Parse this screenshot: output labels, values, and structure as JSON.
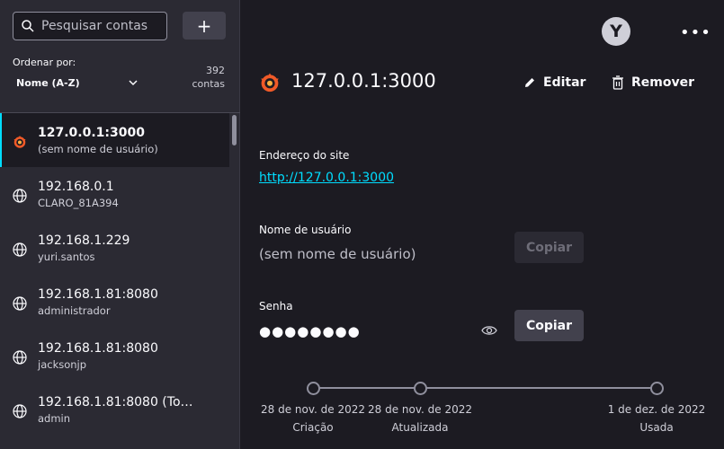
{
  "sidebar": {
    "search_placeholder": "Pesquisar contas",
    "add_label": "+",
    "sort_label": "Ordenar por:",
    "sort_value": "Nome (A-Z)",
    "count_number": "392",
    "count_unit": "contas",
    "items": [
      {
        "title": "127.0.0.1:3000",
        "subtitle": "(sem nome de usuário)",
        "icon": "grafana-logo-icon",
        "active": true
      },
      {
        "title": "192.168.0.1",
        "subtitle": "CLARO_81A394",
        "icon": "globe-icon"
      },
      {
        "title": "192.168.1.229",
        "subtitle": "yuri.santos",
        "icon": "globe-icon"
      },
      {
        "title": "192.168.1.81:8080",
        "subtitle": "administrador",
        "icon": "globe-icon"
      },
      {
        "title": "192.168.1.81:8080",
        "subtitle": "jacksonjp",
        "icon": "globe-icon"
      },
      {
        "title": "192.168.1.81:8080 (To…",
        "subtitle": "admin",
        "icon": "globe-icon"
      }
    ]
  },
  "header": {
    "avatar_letter": "Y",
    "menu_label": "•••"
  },
  "detail": {
    "title": "127.0.0.1:3000",
    "edit_label": "Editar",
    "remove_label": "Remover",
    "site_label": "Endereço do site",
    "site_url": "http://127.0.0.1:3000",
    "username_label": "Nome de usuário",
    "username_value": "(sem nome de usuário)",
    "password_label": "Senha",
    "password_value": "●●●●●●●●",
    "copy_label": "Copiar"
  },
  "timeline": [
    {
      "date": "28 de nov. de 2022",
      "label": "Criação"
    },
    {
      "date": "28 de nov. de 2022",
      "label": "Atualizada"
    },
    {
      "date": "1 de dez. de 2022",
      "label": "Usada"
    }
  ],
  "colors": {
    "accent": "#00ddff",
    "background": "#1c1b22",
    "sidebar": "#2b2a33",
    "grafana_orange": "#f05a28"
  }
}
